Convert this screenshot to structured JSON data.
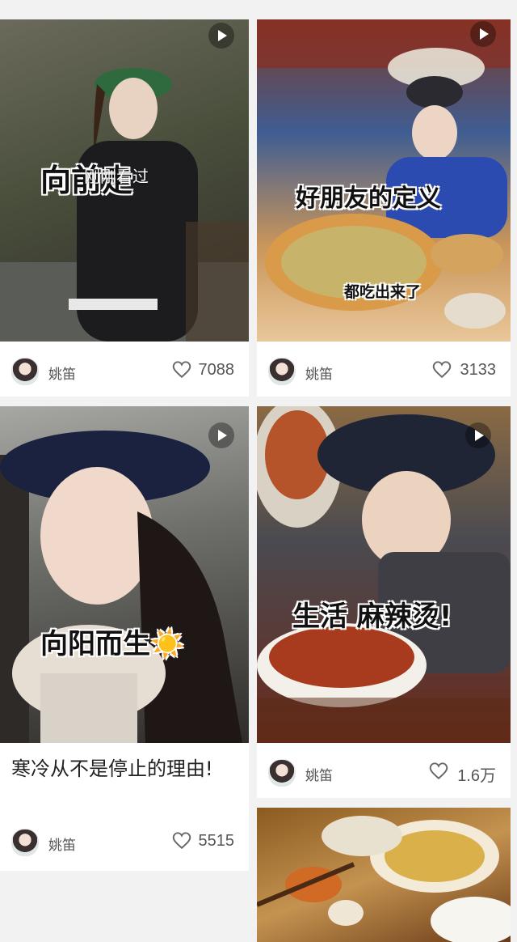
{
  "feed": {
    "cards": [
      {
        "id": "c1",
        "overlay_text": "向前走",
        "recent_tag": "刚刚看过",
        "author": "姚笛",
        "likes": "7088",
        "colors": [
          "#5b5a4f",
          "#2f3a2a",
          "#7a7b70"
        ]
      },
      {
        "id": "c2",
        "overlay_text": "好朋友的定义",
        "sub_text": "都吃出来了",
        "author": "姚笛",
        "likes": "3133",
        "colors": [
          "#b04a2a",
          "#3b5fa0",
          "#e6b678"
        ]
      },
      {
        "id": "c3",
        "overlay_text": "向阳而生☀️",
        "caption": "寒冷从不是停止的理由!",
        "author": "姚笛",
        "likes": "5515",
        "colors": [
          "#8c8f8c",
          "#1c2340",
          "#d8cfc4"
        ]
      },
      {
        "id": "c4",
        "overlay_text": "生活  麻辣烫!",
        "author": "姚笛",
        "likes": "1.6万",
        "colors": [
          "#7a5a3a",
          "#2a2c38",
          "#b44a2c"
        ]
      },
      {
        "id": "c5",
        "colors": [
          "#8a5a20",
          "#e1b766",
          "#4a2a14"
        ]
      }
    ]
  }
}
